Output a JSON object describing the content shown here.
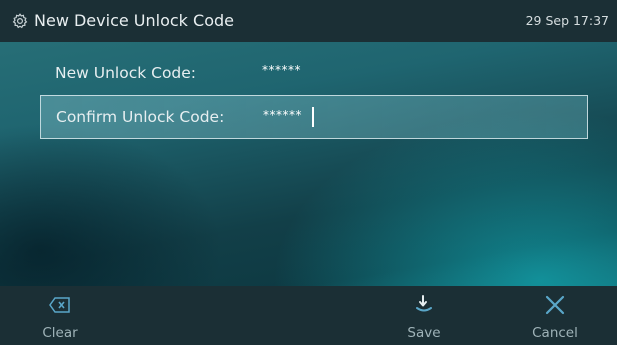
{
  "header": {
    "title": "New Device Unlock Code",
    "clock": "29 Sep 17:37",
    "icon": "gear-icon"
  },
  "form": {
    "new_code": {
      "label": "New Unlock Code:",
      "value": "******"
    },
    "confirm_code": {
      "label": "Confirm Unlock Code:",
      "value": "******"
    }
  },
  "softkeys": {
    "clear": {
      "label": "Clear",
      "icon": "backspace-icon"
    },
    "save": {
      "label": "Save",
      "icon": "save-icon"
    },
    "cancel": {
      "label": "Cancel",
      "icon": "close-icon"
    }
  },
  "colors": {
    "bar": "#1b2f35",
    "accent": "#5aa7c9"
  }
}
